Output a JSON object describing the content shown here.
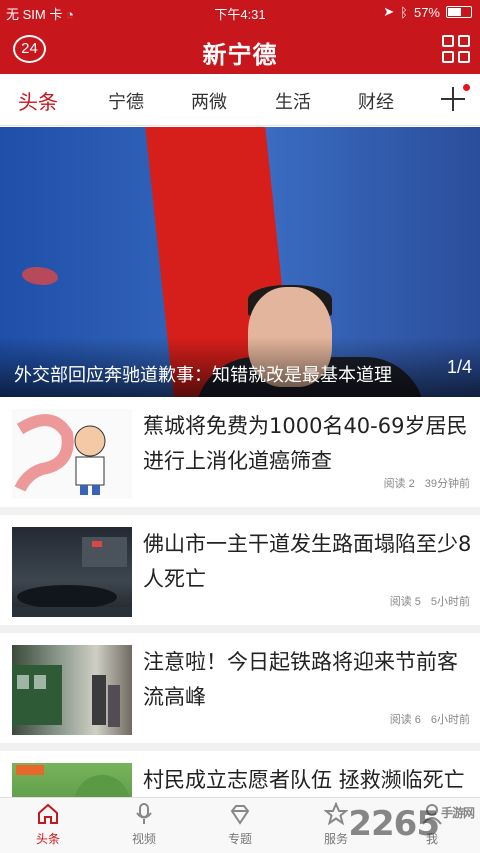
{
  "status_bar": {
    "carrier": "无 SIM 卡",
    "time": "下午4:31",
    "battery": "57%",
    "battery_level": 0.57
  },
  "header": {
    "left_badge": "24",
    "brand": "新宁德"
  },
  "tabs": [
    "头条",
    "宁德",
    "两微",
    "生活",
    "财经"
  ],
  "hero": {
    "title": "外交部回应奔驰道歉事：知错就改是最基本道理",
    "page_current": "1",
    "page_total": "4"
  },
  "news": [
    {
      "title": "蕉城将免费为1000名40-69岁居民进行上消化道癌筛查",
      "reads": "阅读 2",
      "time": "39分钟前"
    },
    {
      "title": "佛山市一主干道发生路面塌陷至少8人死亡",
      "reads": "阅读 5",
      "time": "5小时前"
    },
    {
      "title": "注意啦！今日起铁路将迎来节前客流高峰",
      "reads": "阅读 6",
      "time": "6小时前"
    },
    {
      "title": "村民成立志愿者队伍  拯救濒临死亡的树",
      "reads": "",
      "time": ""
    }
  ],
  "bottom_nav": [
    "头条",
    "视频",
    "专题",
    "服务",
    "我"
  ],
  "watermark": {
    "text": "2265",
    "sub": "手游网"
  },
  "colors": {
    "brand_red": "#c8161d"
  }
}
